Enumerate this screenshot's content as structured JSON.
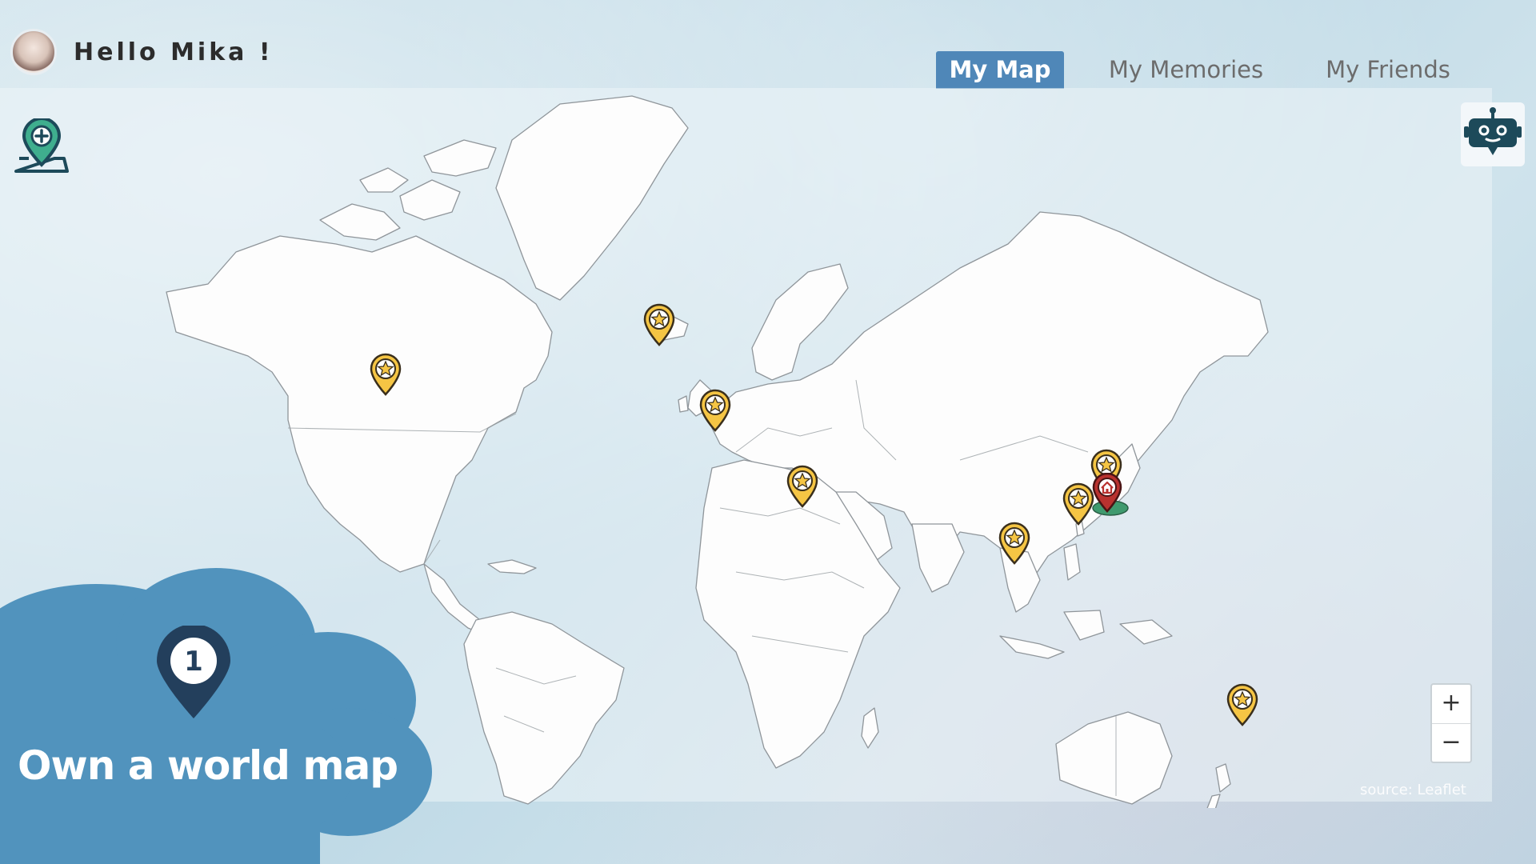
{
  "header": {
    "greeting": "Hello Mika !",
    "tabs": [
      {
        "label": "My Map",
        "active": true
      },
      {
        "label": "My Memories",
        "active": false
      },
      {
        "label": "My Friends",
        "active": false
      }
    ]
  },
  "map": {
    "attribution": "source: Leaflet",
    "zoom_in_label": "+",
    "zoom_out_label": "−",
    "markers": [
      {
        "place": "Canada",
        "type": "star"
      },
      {
        "place": "Iceland",
        "type": "star"
      },
      {
        "place": "United Kingdom",
        "type": "star"
      },
      {
        "place": "Egypt",
        "type": "star"
      },
      {
        "place": "Thailand",
        "type": "star"
      },
      {
        "place": "Hong Kong",
        "type": "star"
      },
      {
        "place": "Korea",
        "type": "star"
      },
      {
        "place": "Taiwan",
        "type": "home"
      },
      {
        "place": "New Zealand",
        "type": "star"
      }
    ]
  },
  "feature": {
    "step": "1",
    "title": "Own a world map"
  },
  "colors": {
    "accent": "#4f87b8",
    "cloud": "#5193bd",
    "marker_gold": "#f5c544",
    "marker_home": "#b9322f",
    "icon_dark": "#1d4a5a",
    "pin_dark": "#233f5c"
  },
  "icons": {
    "add_location": "map-pin-plus-icon",
    "assistant": "robot-chat-icon",
    "step": "location-pin-number-icon"
  }
}
